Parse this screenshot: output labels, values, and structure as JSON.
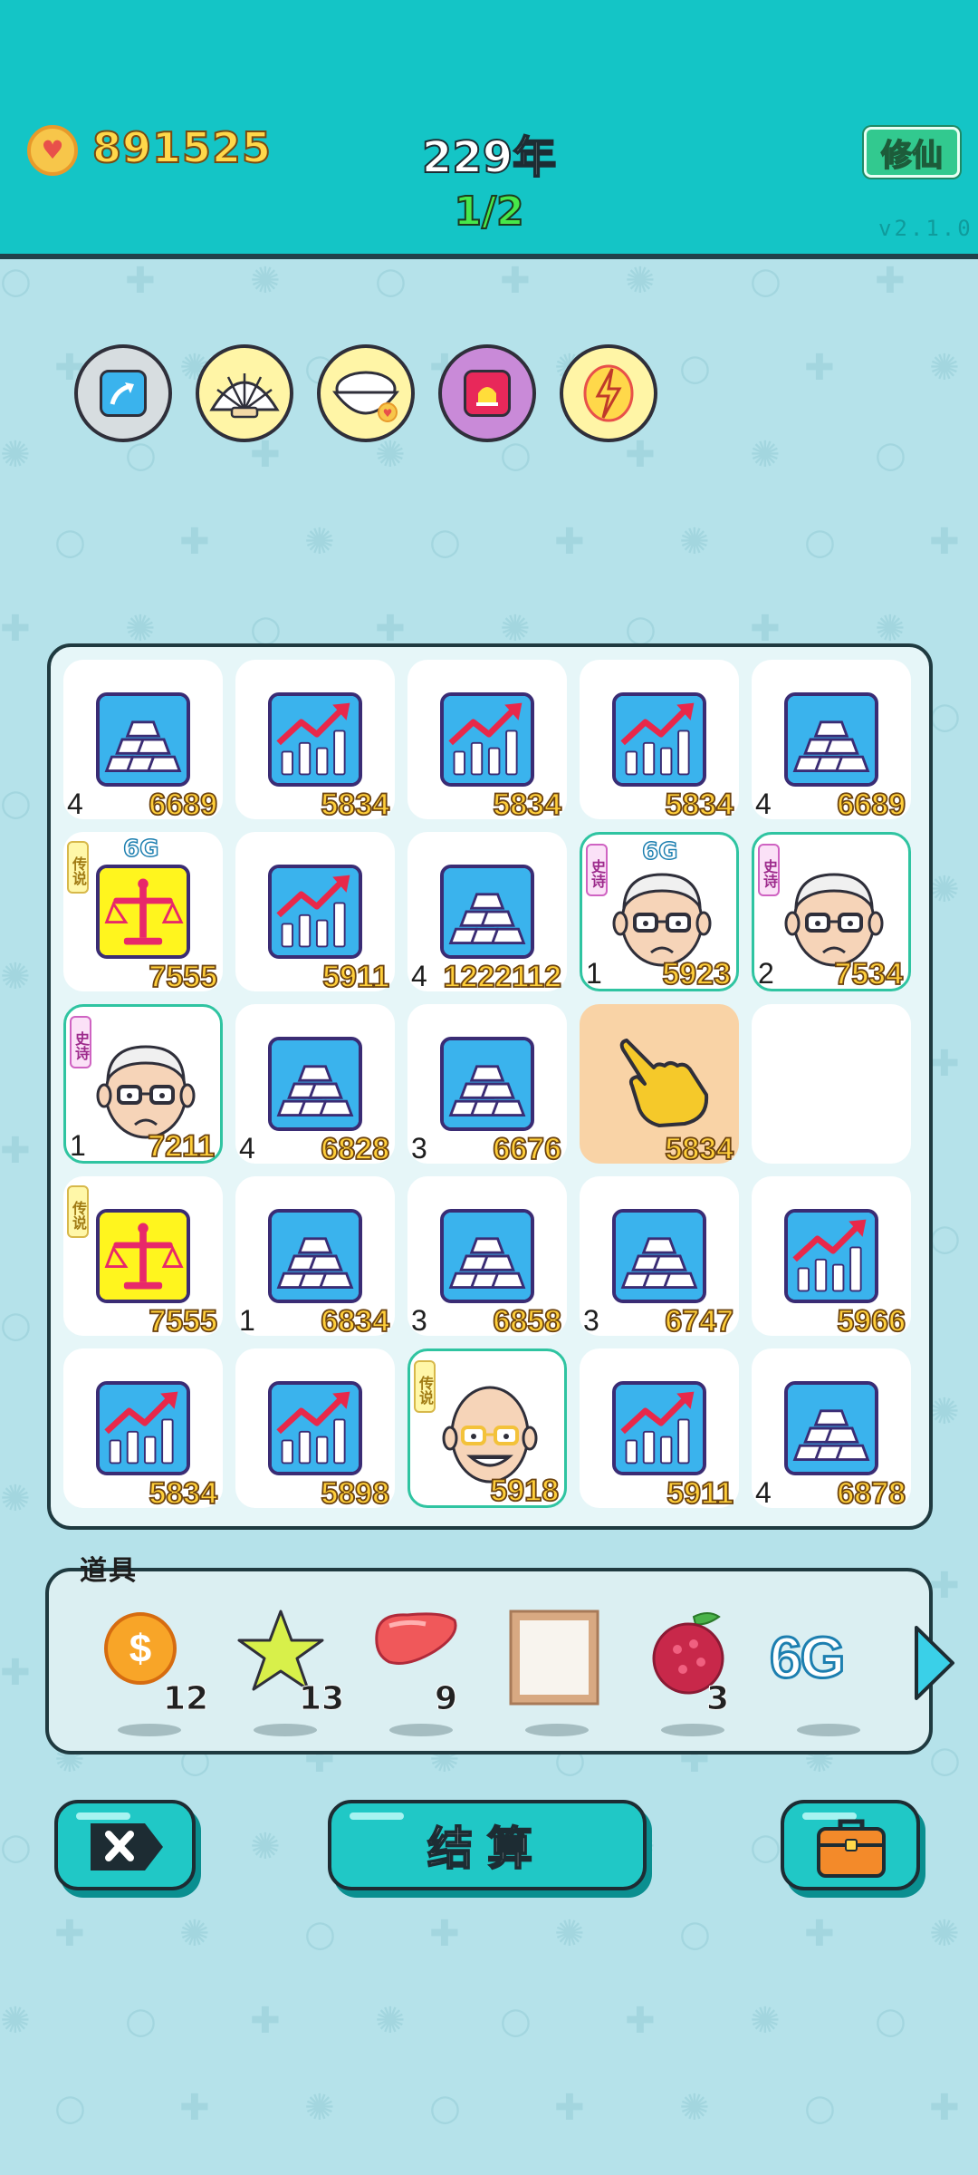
{
  "header": {
    "coins": "891525",
    "year": "229年",
    "progress": "1/2",
    "cultivate_label": "修仙",
    "version": "v2.1.0"
  },
  "skills": [
    {
      "icon": "upgrade-arrow-icon",
      "color": "#d7dde0"
    },
    {
      "icon": "shell-icon",
      "color": "#fff5a6"
    },
    {
      "icon": "rice-bowl-icon",
      "color": "#fff5a6"
    },
    {
      "icon": "alarm-icon",
      "color": "#c98ad8"
    },
    {
      "icon": "lightning-icon",
      "color": "#fff5a6"
    }
  ],
  "board": {
    "cells": [
      {
        "type": "gold",
        "level": "4",
        "price": "6689"
      },
      {
        "type": "chart",
        "level": "",
        "price": "5834"
      },
      {
        "type": "chart",
        "level": "",
        "price": "5834"
      },
      {
        "type": "chart",
        "level": "",
        "price": "5834"
      },
      {
        "type": "gold",
        "level": "4",
        "price": "6689"
      },
      {
        "type": "scale",
        "level": "",
        "price": "7555",
        "tag": "传说",
        "badge": "6G"
      },
      {
        "type": "chart",
        "level": "",
        "price": "5911"
      },
      {
        "type": "gold",
        "level": "4",
        "price": "1222112"
      },
      {
        "type": "oldman",
        "level": "1",
        "price": "5923",
        "tag": "史诗",
        "badge": "6G"
      },
      {
        "type": "oldman",
        "level": "2",
        "price": "7534",
        "tag": "史诗"
      },
      {
        "type": "oldman",
        "level": "1",
        "price": "7211",
        "tag": "史诗"
      },
      {
        "type": "gold",
        "level": "4",
        "price": "6828"
      },
      {
        "type": "gold",
        "level": "3",
        "price": "6676"
      },
      {
        "type": "cursor",
        "level": "",
        "price": "5834"
      },
      {
        "type": "empty",
        "level": "",
        "price": ""
      },
      {
        "type": "scale",
        "level": "",
        "price": "7555",
        "tag": "传说"
      },
      {
        "type": "gold",
        "level": "1",
        "price": "6834"
      },
      {
        "type": "gold",
        "level": "3",
        "price": "6858"
      },
      {
        "type": "gold",
        "level": "3",
        "price": "6747"
      },
      {
        "type": "chart",
        "level": "",
        "price": "5966"
      },
      {
        "type": "chart",
        "level": "",
        "price": "5834"
      },
      {
        "type": "chart",
        "level": "",
        "price": "5898"
      },
      {
        "type": "baldman",
        "level": "",
        "price": "5918",
        "tag": "传说"
      },
      {
        "type": "chart",
        "level": "",
        "price": "5911"
      },
      {
        "type": "gold",
        "level": "4",
        "price": "6878"
      }
    ]
  },
  "props": {
    "label": "道具",
    "items": [
      {
        "icon": "dollar-coin-icon",
        "count": "12"
      },
      {
        "icon": "star-icon",
        "count": "13"
      },
      {
        "icon": "liver-icon",
        "count": "9"
      },
      {
        "icon": "picture-frame-icon",
        "count": ""
      },
      {
        "icon": "bayberry-icon",
        "count": "3"
      },
      {
        "icon": "6g-icon",
        "count": "",
        "text": "6G"
      }
    ]
  },
  "buttons": {
    "settle_label": "结算"
  },
  "colors": {
    "topbar": "#14c5c6",
    "background": "#b5e2ea",
    "accent": "#20c8c6",
    "price_yellow": "#ffcf3a"
  }
}
